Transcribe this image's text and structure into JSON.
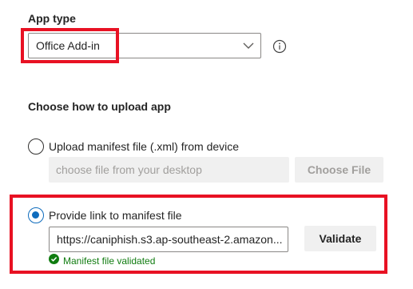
{
  "app_type": {
    "heading": "App type",
    "selected": "Office Add-in",
    "chevron_icon": "chevron-down-icon",
    "info_icon": "info-icon"
  },
  "upload": {
    "heading": "Choose how to upload app",
    "option_device": {
      "label": "Upload manifest file (.xml) from device",
      "selected": false,
      "placeholder": "choose file from your desktop",
      "button": "Choose File"
    },
    "option_link": {
      "label": "Provide link to manifest file",
      "selected": true,
      "url_value": "https://caniphish.s3.ap-southeast-2.amazon...",
      "button": "Validate",
      "status": "Manifest file validated",
      "status_icon": "check-circle-icon"
    }
  },
  "colors": {
    "highlight": "#e81123",
    "accent": "#0f6cbd",
    "success": "#107c10"
  }
}
